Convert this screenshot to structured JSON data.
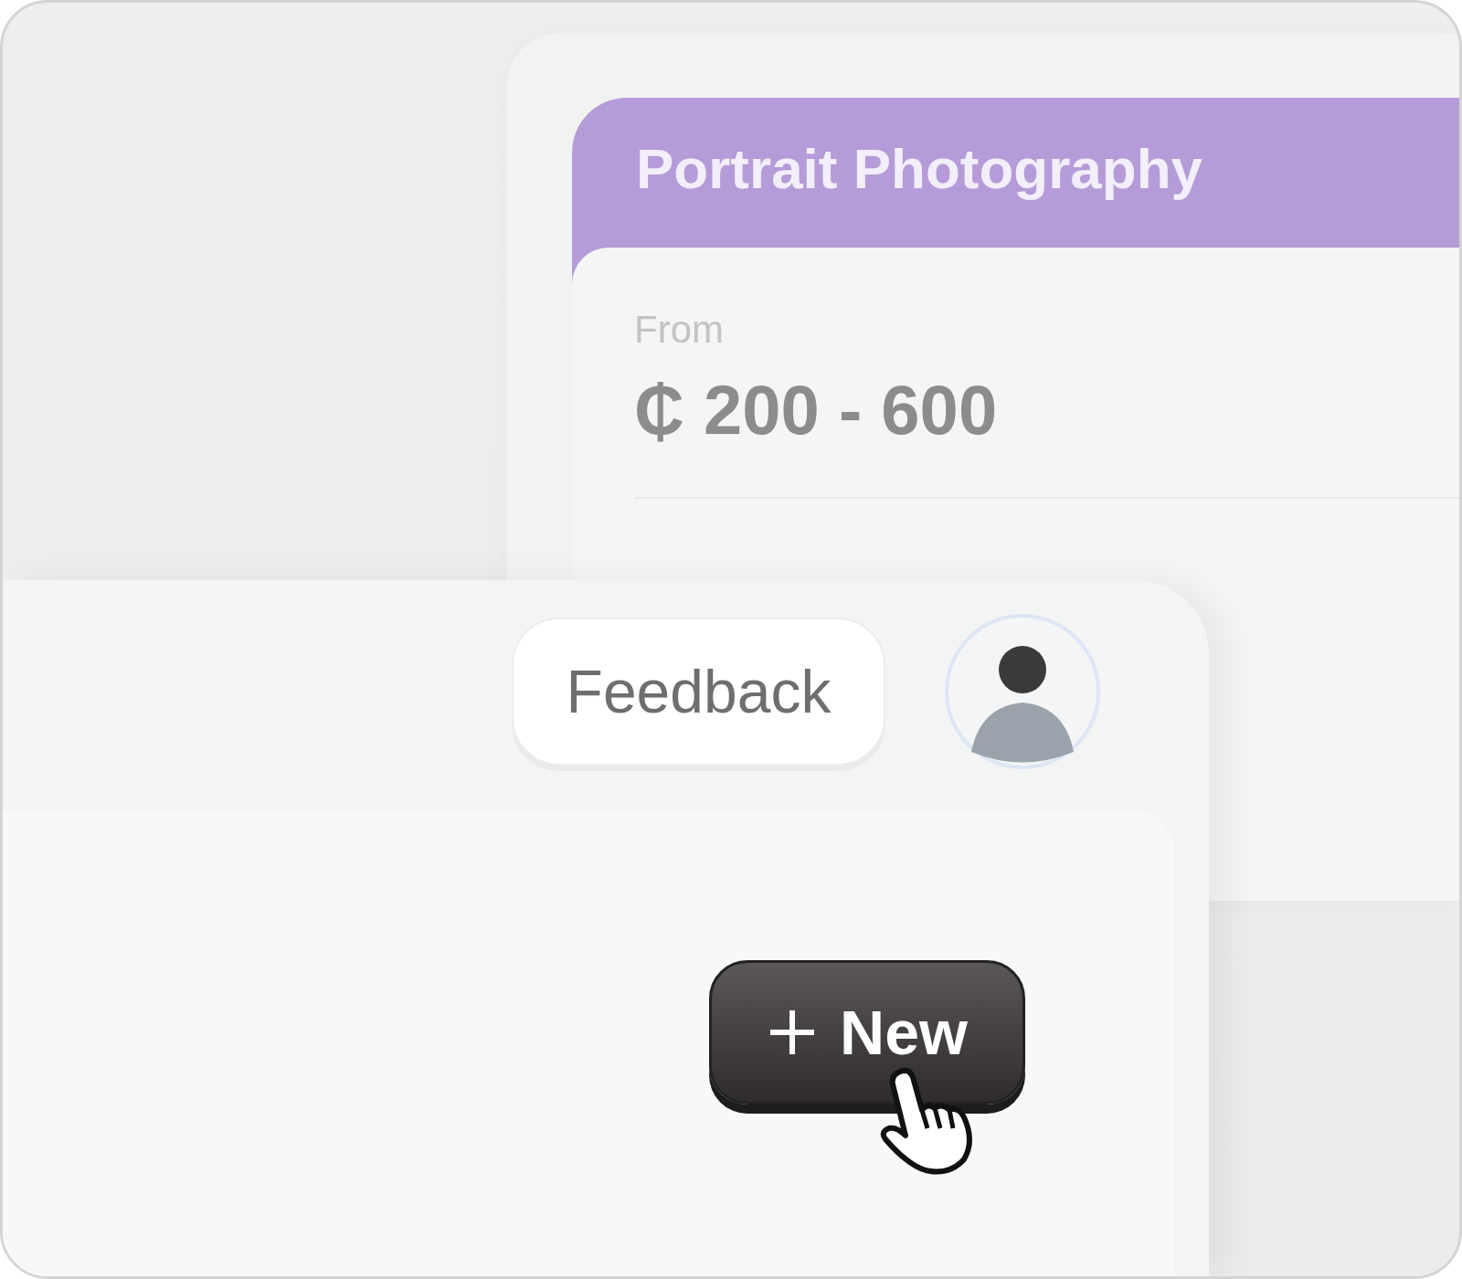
{
  "service_card": {
    "title": "Portrait Photography",
    "price_label": "From",
    "price": "₵ 200 - 600"
  },
  "toolbar": {
    "feedback_button": "Feedback"
  },
  "new_button": {
    "label": "New"
  }
}
